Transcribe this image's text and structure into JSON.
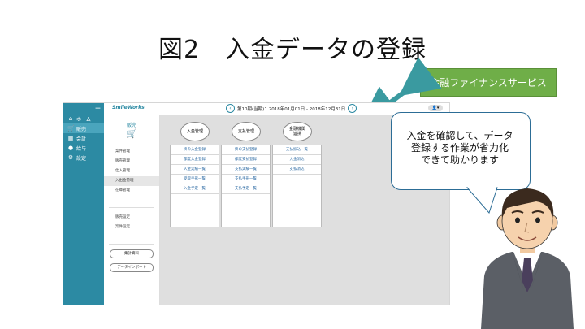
{
  "slide": {
    "title": "図2　入金データの登録"
  },
  "badge": {
    "label": "金融ファイナンスサービス",
    "color": "#6fae48"
  },
  "bubble": {
    "lines": [
      "入金を確認して、データ",
      "登録する作業が省力化",
      "できて助かります"
    ]
  },
  "app": {
    "accent": "#2c8aa3",
    "hamburger": "☰",
    "sidebar": [
      {
        "icon": "home-icon",
        "glyph": "⌂",
        "label": "ホーム"
      },
      {
        "icon": "cart-icon",
        "glyph": "🛒",
        "label": "販売",
        "active": true
      },
      {
        "icon": "ledger-icon",
        "glyph": "▦",
        "label": "会計"
      },
      {
        "icon": "moneybag-icon",
        "glyph": "●",
        "label": "給与"
      },
      {
        "icon": "gear-icon",
        "glyph": "⚙",
        "label": "設定"
      }
    ],
    "topbar": {
      "logo": "SmileWorks",
      "period": "第10期(当期)：2018年01月01日 - 2018年12月31日",
      "prev": "‹",
      "next": "›",
      "user": "👤▾"
    },
    "subnav": {
      "category": "販売",
      "items": [
        "案件管理",
        "販売管理",
        "仕入管理",
        "入出金管理",
        "在庫管理"
      ],
      "active_index": 3,
      "settings": [
        "販売設定",
        "案件設定"
      ],
      "buttons": [
        "集計資料",
        "データインポート"
      ]
    },
    "columns": [
      {
        "head": "入金管理",
        "rows": [
          "掛の入金登録",
          "都度入金登録",
          "入金実績一覧",
          "受取手形一覧",
          "入金予定一覧"
        ]
      },
      {
        "head": "支払管理",
        "rows": [
          "掛の支払登録",
          "都度支払登録",
          "支払実績一覧",
          "支払手形一覧",
          "支払予定一覧"
        ]
      },
      {
        "head": "金融機関\n連携",
        "rows": [
          "支払振込一覧",
          "入金消込",
          "支払消込"
        ]
      }
    ]
  }
}
